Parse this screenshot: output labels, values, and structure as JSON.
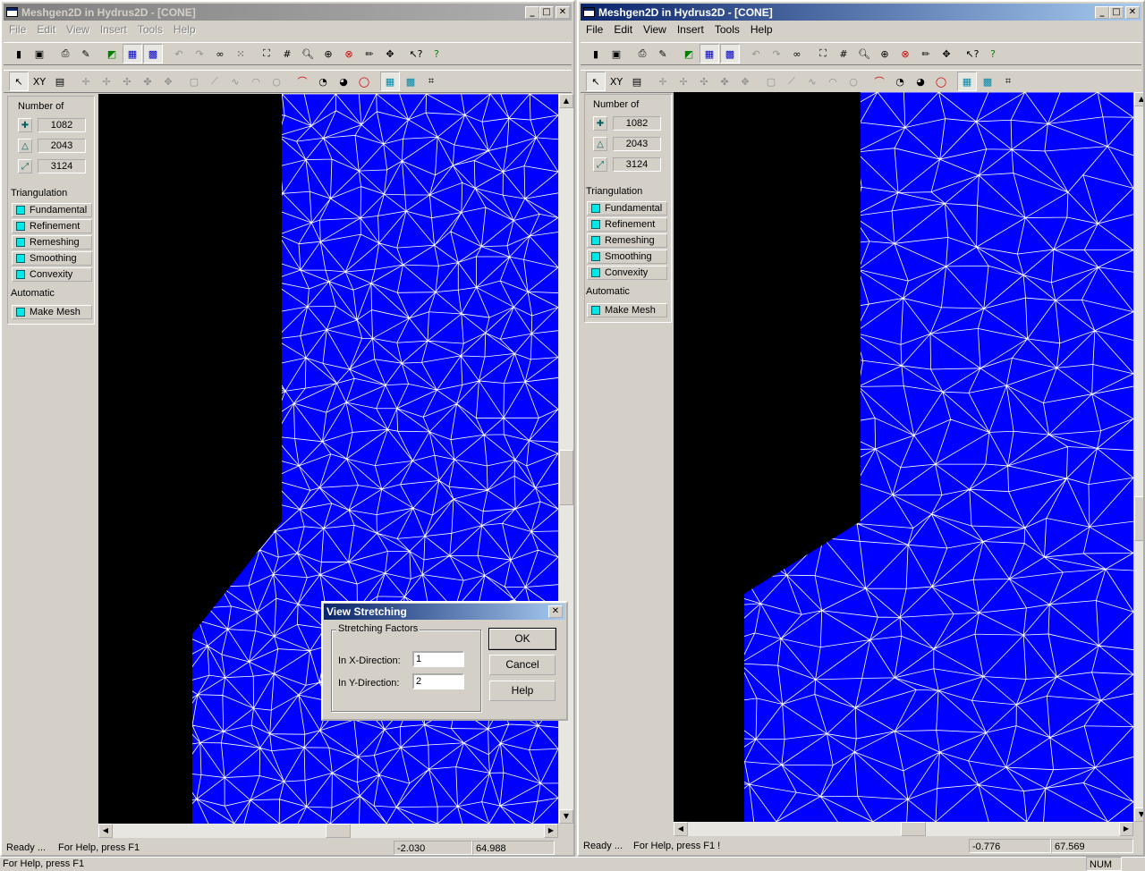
{
  "left_window": {
    "title": "Meshgen2D in Hydrus2D - [CONE]",
    "menu": [
      "File",
      "Edit",
      "View",
      "Insert",
      "Tools",
      "Help"
    ],
    "panel": {
      "number_of_label": "Number of",
      "counts": [
        "1082",
        "2043",
        "3124"
      ],
      "triangulation_label": "Triangulation",
      "triangulation_buttons": [
        "Fundamental",
        "Refinement",
        "Remeshing",
        "Smoothing",
        "Convexity"
      ],
      "automatic_label": "Automatic",
      "make_mesh_label": "Make Mesh"
    },
    "status": {
      "ready": "Ready ...",
      "help": "For Help, press F1",
      "x": "-2.030",
      "y": "64.988"
    }
  },
  "right_window": {
    "title": "Meshgen2D in Hydrus2D - [CONE]",
    "menu": [
      "File",
      "Edit",
      "View",
      "Insert",
      "Tools",
      "Help"
    ],
    "panel": {
      "number_of_label": "Number of",
      "counts": [
        "1082",
        "2043",
        "3124"
      ],
      "triangulation_label": "Triangulation",
      "triangulation_buttons": [
        "Fundamental",
        "Refinement",
        "Remeshing",
        "Smoothing",
        "Convexity"
      ],
      "automatic_label": "Automatic",
      "make_mesh_label": "Make Mesh"
    },
    "status": {
      "ready": "Ready ...",
      "help": "For Help, press F1 !",
      "x": "-0.776",
      "y": "67.569"
    }
  },
  "toolbar2_xy_label": "XY",
  "dialog": {
    "title": "View Stretching",
    "group_label": "Stretching Factors",
    "x_label": "In X-Direction:",
    "x_value": "1",
    "y_label": "In Y-Direction:",
    "y_value": "2",
    "ok_label": "OK",
    "cancel_label": "Cancel",
    "help_label": "Help"
  },
  "app_status": {
    "help": "For Help, press F1",
    "num": "NUM"
  },
  "colors": {
    "mesh_fill": "#0000ff",
    "mesh_lines": "#ffffff",
    "void": "#000000",
    "active_title": "#0a246a"
  }
}
